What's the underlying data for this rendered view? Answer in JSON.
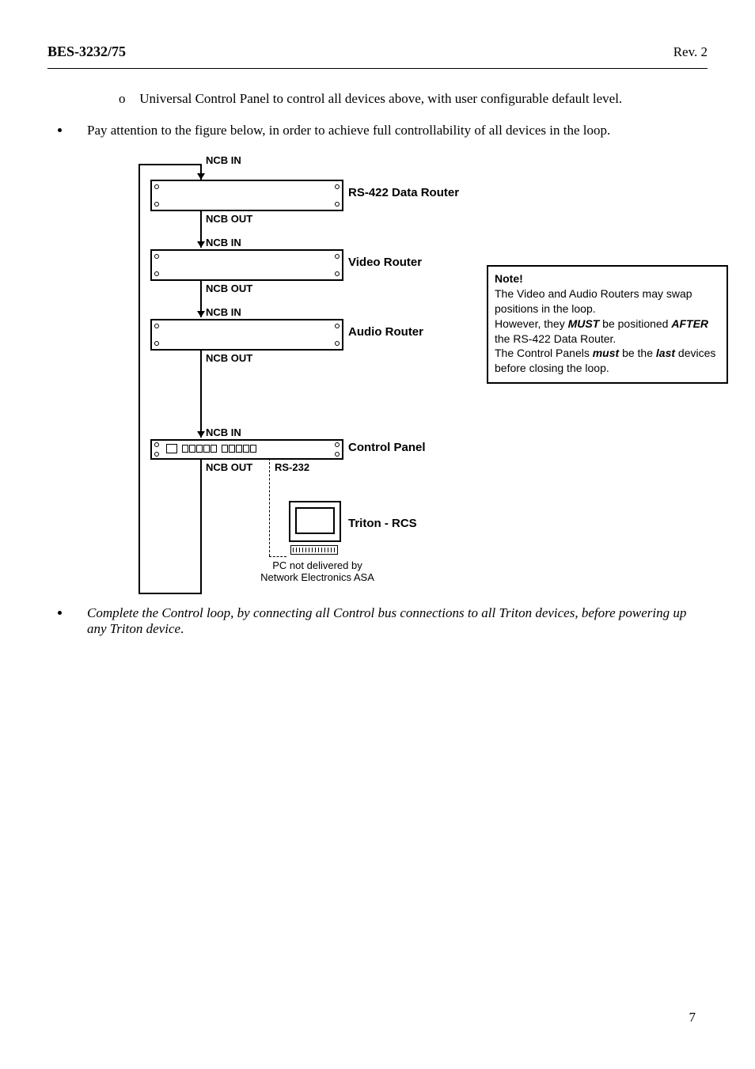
{
  "header": {
    "left": "BES-3232/75",
    "right": "Rev. 2"
  },
  "bullets": {
    "sub_o_marker": "o",
    "sub_o_text": "Universal Control Panel to control all devices above, with user configurable default level.",
    "b1": "Pay attention to the figure below, in order to achieve full controllability of all devices in the loop.",
    "b2": "Complete the Control loop, by connecting all Control bus connections to all Triton devices, before powering up any Triton device"
  },
  "diagram": {
    "ncb_in": "NCB IN",
    "ncb_out": "NCB OUT",
    "d1": "RS-422 Data Router",
    "d2": "Video Router",
    "d3": "Audio Router",
    "d4": "Control Panel",
    "rs232": "RS-232",
    "triton": "Triton - RCS",
    "pc_note_l1": "PC not delivered by",
    "pc_note_l2": "Network Electronics ASA"
  },
  "note": {
    "title": "Note!",
    "l1": "The Video and Audio Routers may swap positions in the loop.",
    "l2a": "However, they ",
    "must": "MUST",
    "l2b": " be positioned ",
    "after": "AFTER",
    "l2c": " the RS-422 Data Router.",
    "l3a": "The Control Panels ",
    "must2": "must",
    "l3b": " be the ",
    "last": "last",
    "l3c": " devices before closing the loop."
  },
  "page_number": "7"
}
